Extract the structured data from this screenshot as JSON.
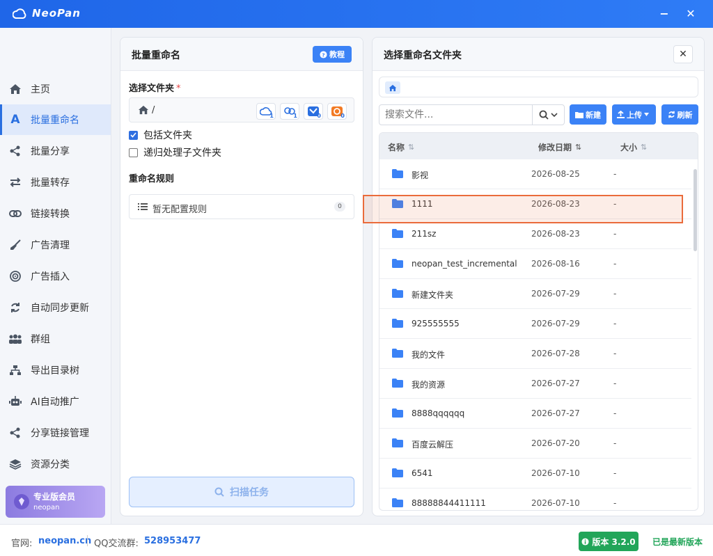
{
  "app": {
    "title": "NeoPan"
  },
  "sidebar": {
    "items": [
      {
        "label": "主页",
        "icon": "home-icon"
      },
      {
        "label": "批量重命名",
        "icon": "letter-a-icon",
        "active": true
      },
      {
        "label": "批量分享",
        "icon": "share-icon"
      },
      {
        "label": "批量转存",
        "icon": "transfer-icon"
      },
      {
        "label": "链接转换",
        "icon": "link-icon"
      },
      {
        "label": "广告清理",
        "icon": "broom-icon"
      },
      {
        "label": "广告插入",
        "icon": "target-icon"
      },
      {
        "label": "自动同步更新",
        "icon": "sync-icon"
      },
      {
        "label": "群组",
        "icon": "group-icon"
      },
      {
        "label": "导出目录树",
        "icon": "tree-icon"
      },
      {
        "label": "AI自动推广",
        "icon": "robot-icon"
      },
      {
        "label": "分享链接管理",
        "icon": "share-icon"
      },
      {
        "label": "资源分类",
        "icon": "layers-icon"
      }
    ],
    "vip": {
      "title": "专业版会员",
      "subtitle": "neopan"
    }
  },
  "left_panel": {
    "title": "批量重命名",
    "tutorial_label": "教程",
    "select_folder_label": "选择文件夹",
    "required_mark": "*",
    "current_path": "/",
    "cloud_counts": [
      "1",
      "1",
      "0",
      "0"
    ],
    "include_folders_label": "包括文件夹",
    "include_folders_checked": true,
    "recursive_label": "递归处理子文件夹",
    "recursive_checked": false,
    "rules_label": "重命名规则",
    "no_rules_text": "暂无配置规则",
    "rules_count": "0",
    "scan_label": "扫描任务"
  },
  "right_panel": {
    "title": "选择重命名文件夹",
    "close_label": "✕",
    "search_placeholder": "搜索文件...",
    "new_label": "新建",
    "upload_label": "上传",
    "refresh_label": "刷新",
    "columns": {
      "name": "名称",
      "date": "修改日期",
      "size": "大小"
    },
    "files": [
      {
        "name": "影视",
        "date": "2026-08-25",
        "size": "-"
      },
      {
        "name": "1111",
        "date": "2026-08-23",
        "size": "-",
        "highlighted": true
      },
      {
        "name": "211sz",
        "date": "2026-08-23",
        "size": "-"
      },
      {
        "name": "neopan_test_incremental",
        "date": "2026-08-16",
        "size": "-"
      },
      {
        "name": "新建文件夹",
        "date": "2026-07-29",
        "size": "-"
      },
      {
        "name": "925555555",
        "date": "2026-07-29",
        "size": "-"
      },
      {
        "name": "我的文件",
        "date": "2026-07-28",
        "size": "-"
      },
      {
        "name": "我的资源",
        "date": "2026-07-27",
        "size": "-"
      },
      {
        "name": "8888qqqqqq",
        "date": "2026-07-27",
        "size": "-"
      },
      {
        "name": "百度云解压",
        "date": "2026-07-20",
        "size": "-"
      },
      {
        "name": "6541",
        "date": "2026-07-10",
        "size": "-"
      },
      {
        "name": "88888844411111",
        "date": "2026-07-10",
        "size": "-"
      }
    ]
  },
  "footer": {
    "site_label": "官网:",
    "site_link": "neopan.cn",
    "qq_label": "QQ交流群:",
    "qq_number": "528953477",
    "version_label": "版本 3.2.0",
    "latest_text": "已是最新版本"
  },
  "colors": {
    "accent": "#2f7cf6",
    "highlight": "#ea6b3b",
    "success": "#22a559"
  }
}
